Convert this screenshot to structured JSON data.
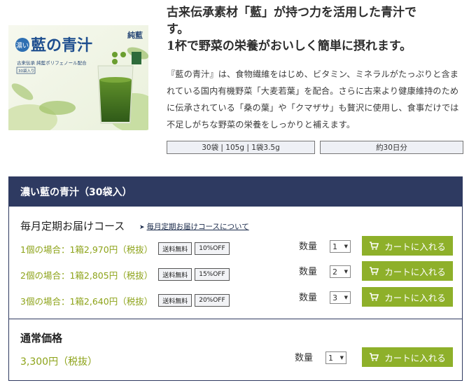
{
  "product": {
    "headline_line1": "古来伝承素材「藍」が持つ力を活用した青汁で",
    "headline_line2": "す。",
    "headline_line3": "1杯で野菜の栄養がおいしく簡単に摂れます。",
    "description": "『藍の青汁』は、食物繊維をはじめ、ビタミン、ミネラルがたっぷりと含まれている国内有機野菜「大麦若葉」を配合。さらに古来より健康維持のために伝承されている「桑の葉」や「クマザサ」も贅沢に使用し、食事だけでは不足しがちな野菜の栄養をしっかりと補えます。",
    "spec_contents": "30袋 | 105g | 1袋3.5g",
    "spec_duration": "約30日分",
    "image": {
      "brand_small": "濃い",
      "brand_main": "藍の青汁",
      "brand_right": "純藍",
      "subtitle": "古来伝承 純藍ポリフェノール配合",
      "pack_note": "30袋入り"
    }
  },
  "panel": {
    "title": "濃い藍の青汁（30袋入）",
    "course_title": "毎月定期お届けコース",
    "course_link": "毎月定期お届けコースについて",
    "qty_label": "数量",
    "cart_label": "カートに入れる",
    "course_rows": [
      {
        "price": "1個の場合：1箱2,970円（税抜）",
        "shipping": "送料無料",
        "discount": "10%OFF",
        "qty": "1"
      },
      {
        "price": "2個の場合：1箱2,805円（税抜）",
        "shipping": "送料無料",
        "discount": "15%OFF",
        "qty": "2"
      },
      {
        "price": "3個の場合：1箱2,640円（税抜）",
        "shipping": "送料無料",
        "discount": "20%OFF",
        "qty": "3"
      }
    ],
    "regular_title": "通常価格",
    "regular_price": "3,300円（税抜）",
    "regular_qty": "1"
  },
  "colors": {
    "header_bg": "#2e3a61",
    "cart_button": "#8eb02a",
    "price_text": "#8da319"
  },
  "icons": {
    "cart": "cart-icon",
    "course_arrow": "arrow-icon",
    "select": "chevron-down-icon"
  }
}
